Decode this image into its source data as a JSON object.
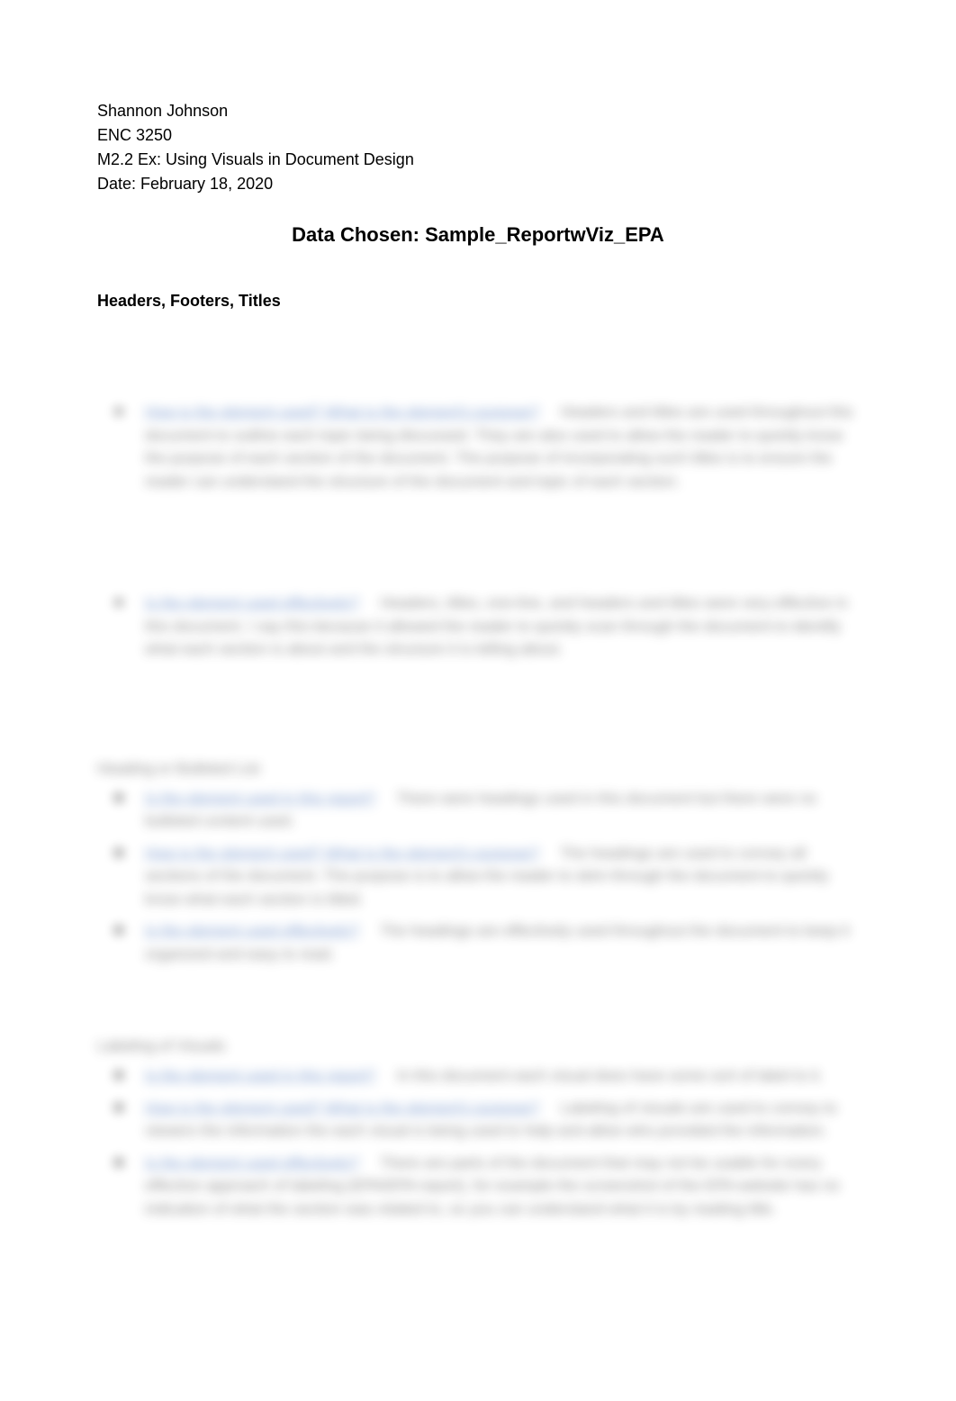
{
  "header": {
    "name": "Shannon Johnson",
    "course": "ENC 3250",
    "assignment": "M2.2 Ex: Using Visuals in Document Design",
    "date": "Date: February 18, 2020"
  },
  "title": "Data Chosen: Sample_ReportwViz_EPA",
  "section1": {
    "heading": "Headers, Footers, Titles",
    "items": [
      {
        "question": "How is the element used? What is the element's purpose?",
        "answer": "Headers and titles are used throughout this document to outline each topic being discussed. They are also used to allow the reader to quickly know the purpose of each section of the document. The purpose of incorporating such titles is to ensure the reader can understand the structure of the document and topic of each section."
      },
      {
        "question": "Is the element used effectively?",
        "answer": "Headers, titles, one-line, and headers and titles were very effective in this document. I say this because it allowed the reader to quickly scan through the document to identify what each section is about and the structure it is telling about."
      }
    ]
  },
  "section2": {
    "heading": "Heading or Bulleted List",
    "items": [
      {
        "question": "Is the element used in this report?",
        "answer": "There were headings used in this document but there were no bulleted content used."
      },
      {
        "question": "How is the element used? What is the element's purpose?",
        "answer": "The headings are used to convey all sections of the document. The purpose is to allow the reader to skim through the document to quickly know what each section is titled."
      },
      {
        "question": "Is the element used effectively?",
        "answer": "The headings are effectively used throughout the document to keep it organized and easy to read."
      }
    ]
  },
  "section3": {
    "heading": "Labeling of Visuals",
    "items": [
      {
        "question": "Is the element used in this report?",
        "answer": "In this document each visual does have some sort of label to it."
      },
      {
        "question": "How is the element used? What is the element's purpose?",
        "answer": "Labeling of visuals are used to convey to viewers the information the each visual is being used to help and allow who provided the information."
      },
      {
        "question": "Is the element used effectively?",
        "answer": "There are parts of the document that may not be usable for every effective approach of labeling (EPA/EPA report), for example the screenshot of the EPA website has no indication of what the section was related to, so you can understand what it is by reading title."
      }
    ]
  }
}
